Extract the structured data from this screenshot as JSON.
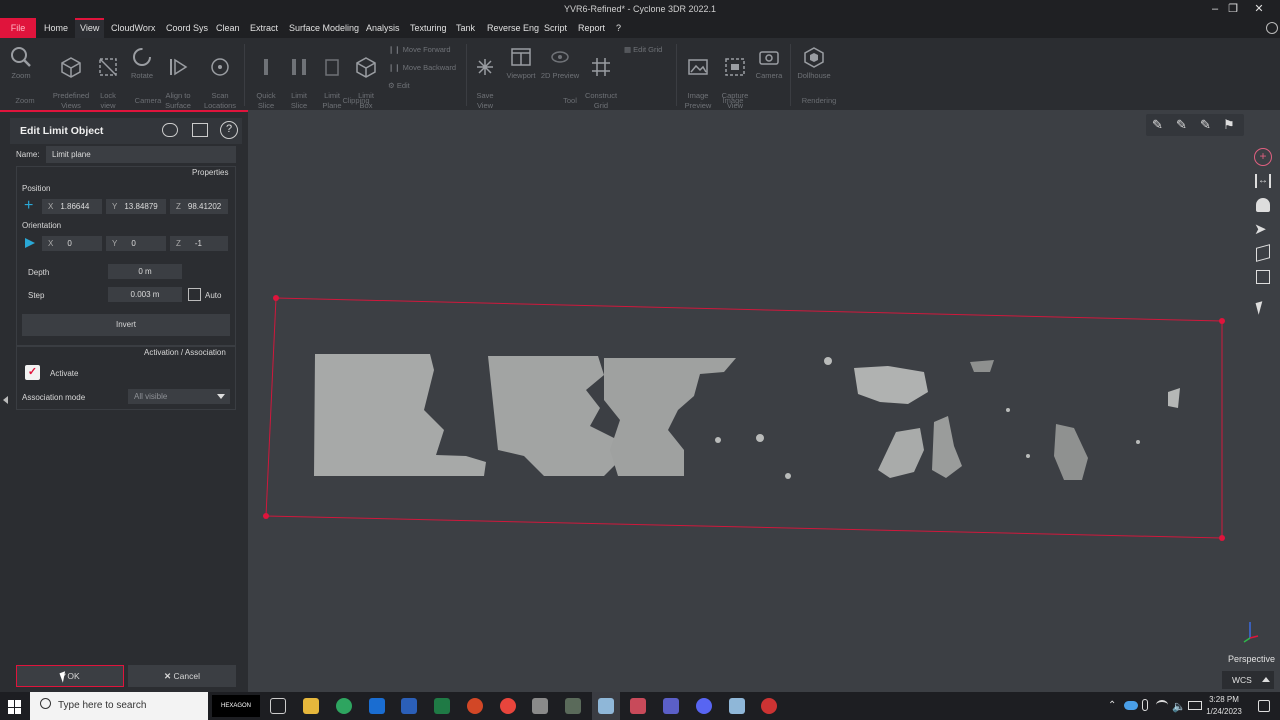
{
  "window": {
    "title": "YVR6-Refined* - Cyclone 3DR 2022.1"
  },
  "menu": {
    "file": "File",
    "items": [
      "Home",
      "View",
      "CloudWorx",
      "Coord Sys",
      "Clean",
      "Extract",
      "Surface Modeling",
      "Analysis",
      "Texturing",
      "Tank",
      "Reverse Eng",
      "Script",
      "Report",
      "?"
    ],
    "active": "View"
  },
  "ribbon": {
    "zoom": "Zoom",
    "predefined_views": "Predefined\nViews",
    "lock_view": "Lock\nview",
    "rotate": "Rotate",
    "align_to_surface": "Align to\nSurface",
    "scan_locations": "Scan\nLocations",
    "quick_slice": "Quick\nSlice",
    "limit_slice": "Limit\nSlice",
    "limit_plane": "Limit\nPlane",
    "limit_box": "Limit\nBox",
    "move_forward": "Move Forward",
    "move_backward": "Move Backward",
    "edit": "Edit",
    "save_view": "Save\nView",
    "viewport": "Viewport",
    "preview_2d": "2D Preview",
    "construct_grid": "Construct\nGrid",
    "edit_grid": "Edit Grid",
    "image_preview": "Image\nPreview",
    "capture_view": "Capture\nView",
    "camera": "Camera",
    "dollhouse": "Dollhouse",
    "groups": {
      "zoom": "Zoom",
      "camera": "Camera",
      "clipping": "Clipping",
      "tool": "Tool",
      "image": "Image",
      "rendering": "Rendering"
    }
  },
  "panel": {
    "title": "Edit Limit Object",
    "name_label": "Name:",
    "name_value": "Limit plane",
    "properties_label": "Properties",
    "position_label": "Position",
    "position": {
      "x_label": "X",
      "x": "1.86644",
      "y_label": "Y",
      "y": "13.84879",
      "z_label": "Z",
      "z": "98.41202"
    },
    "orientation_label": "Orientation",
    "orientation": {
      "x_label": "X",
      "x": "0",
      "y_label": "Y",
      "y": "0",
      "z_label": "Z",
      "z": "-1"
    },
    "depth_label": "Depth",
    "depth_value": "0 m",
    "step_label": "Step",
    "step_value": "0.003 m",
    "auto_label": "Auto",
    "invert_label": "Invert",
    "activation_label": "Activation / Association",
    "activate_label": "Activate",
    "activate_checked": true,
    "association_mode_label": "Association mode",
    "association_mode_value": "All visible",
    "ok_label": "OK",
    "cancel_label": "Cancel"
  },
  "viewport": {
    "projection": "Perspective",
    "coord_system": "WCS",
    "accent_color": "#e0143c"
  },
  "taskbar": {
    "search_placeholder": "Type here to search",
    "hexagon_label": "HEXAGON",
    "time": "3:28 PM",
    "date": "1/24/2023"
  }
}
